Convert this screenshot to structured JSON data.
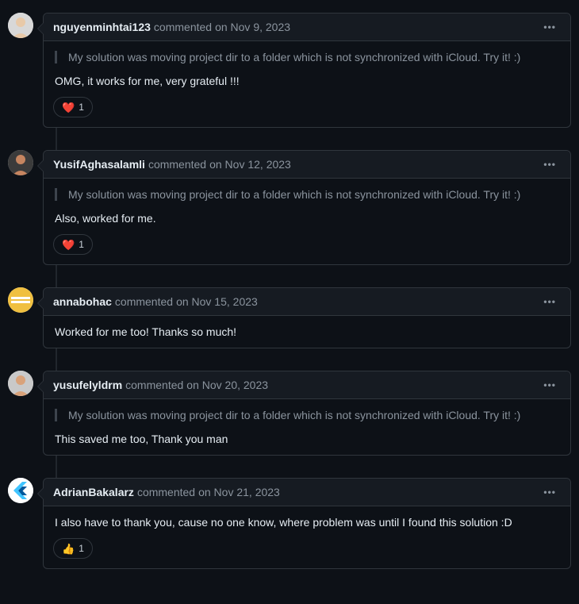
{
  "quote_text": "My solution was moving project dir to a folder which is not synchronized with iCloud. Try it! :)",
  "commented_word": "commented",
  "kebab_glyph": "•••",
  "comments": [
    {
      "author": "nguyenminhtai123",
      "date": "on Nov 9, 2023",
      "has_quote": true,
      "body": "OMG, it works for me, very grateful !!!",
      "reactions": [
        {
          "emoji": "❤️",
          "count": "1"
        }
      ],
      "avatar": "person-1"
    },
    {
      "author": "YusifAghasalamli",
      "date": "on Nov 12, 2023",
      "has_quote": true,
      "body": "Also, worked for me.",
      "reactions": [
        {
          "emoji": "❤️",
          "count": "1"
        }
      ],
      "avatar": "person-2"
    },
    {
      "author": "annabohac",
      "date": "on Nov 15, 2023",
      "has_quote": false,
      "body": "Worked for me too! Thanks so much!",
      "reactions": [],
      "avatar": "logo-yellow"
    },
    {
      "author": "yusufelyldrm",
      "date": "on Nov 20, 2023",
      "has_quote": true,
      "body": "This saved me too, Thank you man",
      "reactions": [],
      "avatar": "person-3"
    },
    {
      "author": "AdrianBakalarz",
      "date": "on Nov 21, 2023",
      "has_quote": false,
      "body": "I also have to thank you, cause no one know, where problem was until I found this solution :D",
      "reactions": [
        {
          "emoji": "👍",
          "count": "1"
        }
      ],
      "avatar": "logo-flutter"
    }
  ]
}
